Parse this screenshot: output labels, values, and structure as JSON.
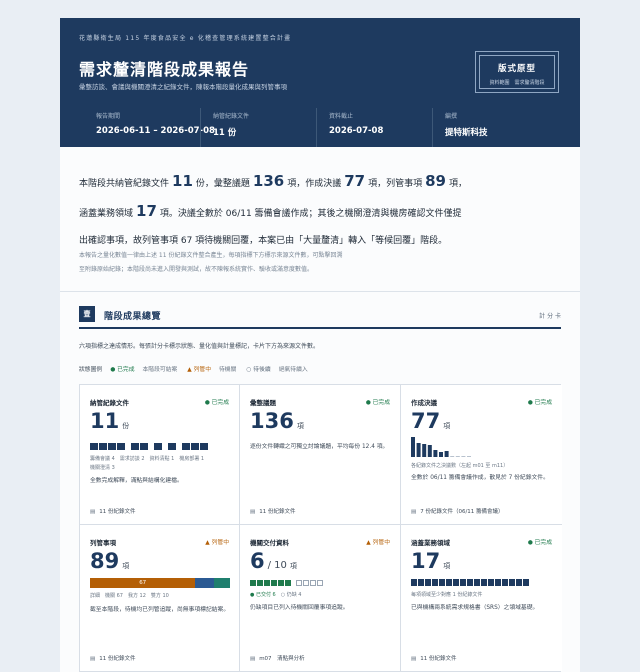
{
  "header": {
    "org": "花蓮縣衛生局 115 年度食品安全 e 化稽查管理系統建置整合計畫",
    "title": "需求釐清階段成果報告",
    "subtitle": "彙整訪談、會議與機關澄清之紀錄文件，陳報本階段量化成果與列管事項",
    "proto_title": "版式原型",
    "proto_sub": "資料範圍　需求釐清階段",
    "meta": [
      {
        "label": "報告期間",
        "value": "2026-06-11 – 2026-07-08"
      },
      {
        "label": "納管紀錄文件",
        "value": "11 份"
      },
      {
        "label": "資料截止",
        "value": "2026-07-08"
      },
      {
        "label": "編撰",
        "value": "提特斯科技"
      }
    ]
  },
  "summary": {
    "p1": "本階段共納管紀錄文件",
    "n_docs": "11",
    "p2": "份，彙整議題",
    "n_issues": "136",
    "p3": "項，作成決議",
    "n_decisions": "77",
    "p4": "項，列管事項",
    "n_tracked": "89",
    "p5": "項，",
    "p6": "涵蓋業務領域",
    "n_domains": "17",
    "p7": "項。決議全數於 06/11 籌備會議作成；其後之機關澄清與機房確認文件僅提",
    "p8": "出確認事項，故列管事項 67 項待機關回覆，本案已由「大量釐清」轉入「等候回覆」階段。",
    "note1": "本報告之量化數值一律由上述 11 份紀錄文件整合產生，每項指標下方標示來源文件數，可點擊回溯",
    "note2": "至附錄原始紀錄；本階段尚未進入開發與測試，故不陳報系統實作、驗收或滿意度數值。"
  },
  "section": {
    "num": "壹",
    "title": "階段成果總覽",
    "right": "計 分 卡",
    "desc": "六項指標之達成情形。每張計分卡標示狀態、量化值與計量標記，卡片下方為來源文件數。",
    "legend_label": "狀態圖例",
    "legend_done": "● 已完成",
    "legend_done_note": "本階段可結案",
    "legend_open": "▲ 列管中",
    "legend_open_note": "待機關",
    "legend_wait": "○ 待後續",
    "legend_wait_note": "絕氣待續入"
  },
  "cards": [
    {
      "title": "納管紀錄文件",
      "status": "● 已完成",
      "value": "11",
      "unit": "份",
      "small1": "籌備會議 4　需求訪談 2　資料清點 1　機房部署 1",
      "small2": "機關澄清 3",
      "text": "全數完成解釋，滿點與結構化建檔。",
      "foot": "11 份紀錄文件"
    },
    {
      "title": "彙整議題",
      "status": "● 已完成",
      "value": "136",
      "unit": "項",
      "text": "逐份文件轉織之可獨立討論議題，平均每份 12.4 項。",
      "foot": "11 份紀錄文件"
    },
    {
      "title": "作成決議",
      "status": "● 已完成",
      "value": "77",
      "unit": "項",
      "small1": "各紀錄文件之決議數（左起 m01 至 m11）",
      "text": "全數於 06/11 籌備會議作成，散見於 7 份紀錄文件。",
      "foot": "7 份紀錄文件（06/11 籌備會議）"
    },
    {
      "title": "列管事項",
      "status": "▲ 列管中",
      "value": "89",
      "unit": "項",
      "bar_label": "67",
      "small1": "詳細　機關 67　我方 12　雙方 10",
      "text": "截至本階段，待機均已列管追蹤，尚無事項標記結案。",
      "foot": "11 份紀錄文件"
    },
    {
      "title": "機關交付資料",
      "status": "▲ 列管中",
      "value": "6",
      "denom": "/ 10",
      "unit": "項",
      "small_done": "● 已交付 6",
      "small_wait": "○ 仍缺 4",
      "text": "仍缺項目已列入待機關回覆事項追蹤。",
      "foot_a": "m07",
      "foot_b": "清點與分析"
    },
    {
      "title": "涵蓋業務領域",
      "status": "● 已完成",
      "value": "17",
      "unit": "項",
      "small1": "每項領域至少對應 1 份紀錄文件",
      "text": "已與機構兩系統需求規格書（SRS）之領域基礎。",
      "foot": "11 份紀錄文件"
    }
  ],
  "chart_data": {
    "type": "bar",
    "categories": [
      "m01",
      "m02",
      "m03",
      "m04",
      "m05",
      "m06",
      "m07",
      "m08",
      "m09",
      "m10",
      "m11"
    ],
    "values": [
      20,
      14,
      13,
      12,
      7,
      5,
      6,
      0,
      0,
      0,
      0
    ],
    "stacked_tracked": [
      {
        "name": "機關",
        "value": 67,
        "color": "#b45f06"
      },
      {
        "name": "我方",
        "value": 12,
        "color": "#2b5a93"
      },
      {
        "name": "雙方",
        "value": 10,
        "color": "#1f7f6e"
      }
    ],
    "delivered": 6,
    "delivered_total": 10
  }
}
